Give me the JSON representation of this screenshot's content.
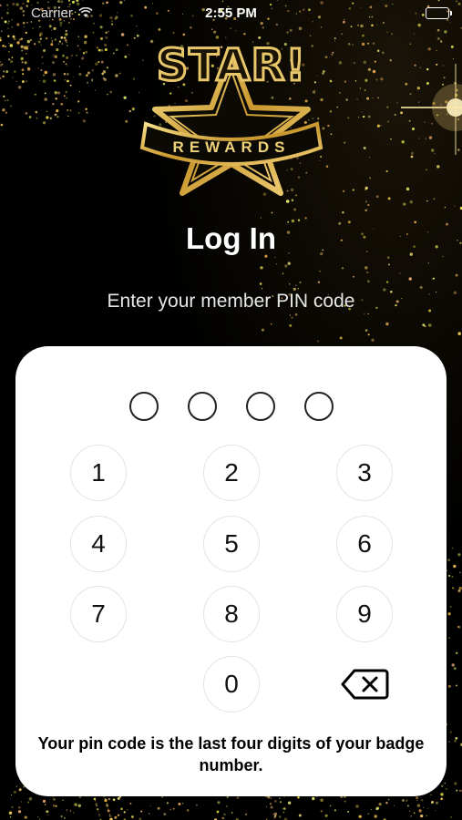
{
  "status_bar": {
    "carrier": "Carrier",
    "time": "2:55 PM"
  },
  "logo": {
    "brand": "STAR!",
    "sub": "REWARDS"
  },
  "title": "Log In",
  "subtitle": "Enter your member PIN code",
  "pin": {
    "dot_count": 4,
    "keys": [
      "1",
      "2",
      "3",
      "4",
      "5",
      "6",
      "7",
      "8",
      "9",
      "0"
    ],
    "hint": "Your pin code is the last four digits of your badge number."
  },
  "colors": {
    "background": "#000000",
    "gold": "#e8c66a",
    "card": "#ffffff"
  }
}
